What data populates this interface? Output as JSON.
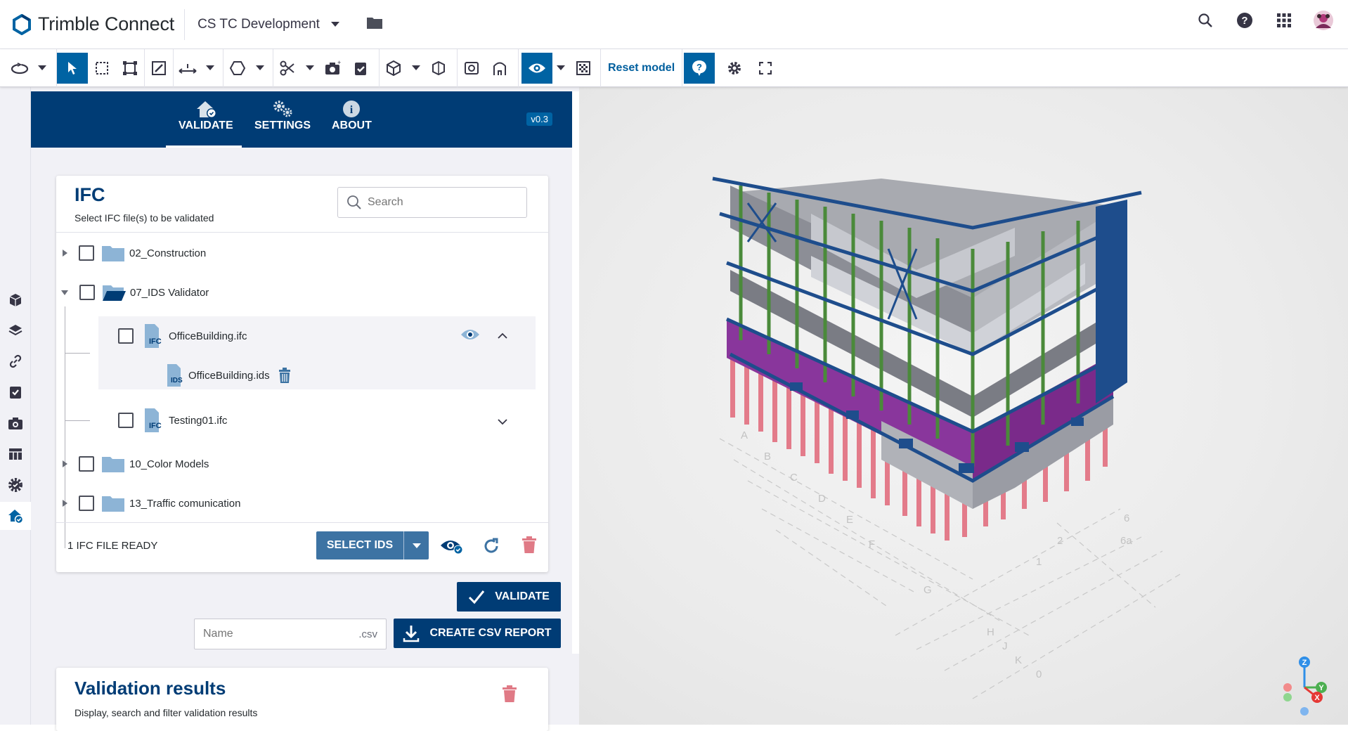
{
  "header": {
    "brand": "Trimble Connect",
    "project": "CS TC Development"
  },
  "toolbar": {
    "reset_label": "Reset model"
  },
  "extension": {
    "tabs": [
      {
        "label": "VALIDATE",
        "icon": "home-check-icon",
        "active": true
      },
      {
        "label": "SETTINGS",
        "icon": "gears-icon",
        "active": false
      },
      {
        "label": "ABOUT",
        "icon": "info-icon",
        "active": false
      }
    ],
    "version": "v0.3"
  },
  "ifc": {
    "title": "IFC",
    "subtitle": "Select IFC file(s) to be validated",
    "search_placeholder": "Search",
    "folders": [
      {
        "name": "02_Construction",
        "expanded": false
      },
      {
        "name": "07_IDS Validator",
        "expanded": true
      },
      {
        "name": "10_Color Models",
        "expanded": false
      },
      {
        "name": "13_Traffic comunication",
        "expanded": false
      }
    ],
    "files": [
      {
        "name": "OfficeBuilding.ifc",
        "badge": "IFC",
        "ids": "OfficeBuilding.ids",
        "ids_badge": "IDS"
      },
      {
        "name": "Testing01.ifc",
        "badge": "IFC"
      }
    ],
    "status": "1 IFC FILE READY",
    "select_ids_label": "SELECT IDS"
  },
  "actions": {
    "validate_label": "VALIDATE",
    "name_placeholder": "Name",
    "name_suffix": ".csv",
    "csv_label": "CREATE CSV REPORT"
  },
  "results": {
    "title": "Validation results",
    "subtitle": "Display, search and filter validation results"
  },
  "axes": {
    "z": "Z",
    "y": "Y",
    "x": "X"
  },
  "grid_labels": [
    "A",
    "B",
    "C",
    "D",
    "E",
    "F",
    "G",
    "H",
    "J",
    "K",
    "1",
    "2",
    "6",
    "6a",
    "0"
  ],
  "colors": {
    "brand_dark": "#003c75",
    "accent": "#0063a3",
    "danger": "#e07a86"
  }
}
